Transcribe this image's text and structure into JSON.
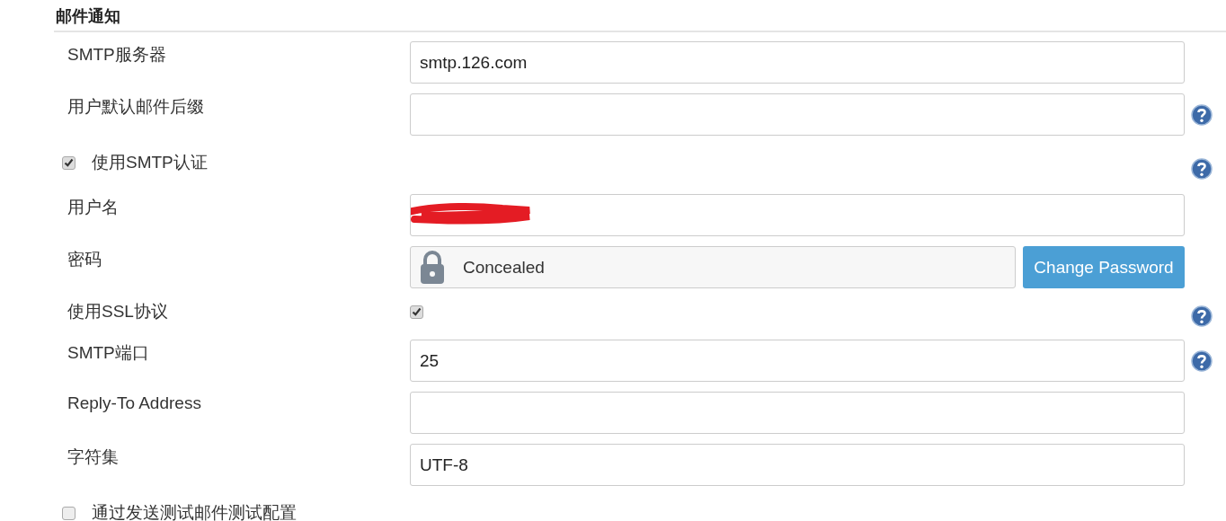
{
  "section": {
    "title": "邮件通知"
  },
  "rows": [
    {
      "kind": "text",
      "label": "SMTP服务器",
      "value": "smtp.126.com",
      "help": false
    },
    {
      "kind": "text",
      "label": "用户默认邮件后缀",
      "help": true
    },
    {
      "kind": "toggle",
      "label": "使用SMTP认证",
      "checked": true,
      "help": true
    },
    {
      "kind": "text",
      "label": "用户名",
      "redacted": true,
      "help": false
    },
    {
      "kind": "password",
      "label": "密码",
      "value": "Concealed",
      "button": "Change Password",
      "help": false
    },
    {
      "kind": "check",
      "label": "使用SSL协议",
      "checked": true,
      "help": true
    },
    {
      "kind": "text",
      "label": "SMTP端口",
      "value": "25",
      "help": true
    },
    {
      "kind": "text",
      "label": "Reply-To Address",
      "help": false
    },
    {
      "kind": "text",
      "label": "字符集",
      "value": "UTF-8",
      "help": false
    },
    {
      "kind": "toggle",
      "label": "通过发送测试邮件测试配置",
      "checked": false,
      "help": false
    }
  ]
}
